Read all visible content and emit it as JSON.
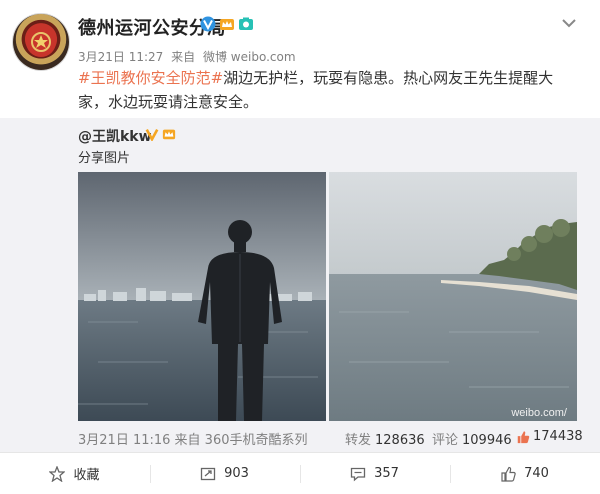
{
  "header": {
    "author": "德州运河公安分局",
    "badges": [
      "verified-v-icon",
      "crown-icon",
      "camera-icon"
    ]
  },
  "meta": {
    "time": "3月21日 11:27",
    "via_prefix": "来自",
    "source": "微博 weibo.com"
  },
  "content": {
    "topic": "#王凯教你安全防范#",
    "text": "湖边无护栏，玩耍有隐患。热心网友王先生提醒大家，水边玩耍请注意安全。"
  },
  "repost": {
    "user": "@王凯kkw",
    "text": "分享图片",
    "time": "3月21日 11:16 来自 360手机奇酷系列",
    "repost_label": "转发",
    "repost_count": "128636",
    "comment_label": "评论",
    "comment_count": "109946",
    "like_count": "174438",
    "watermark": "weibo.com/"
  },
  "actions": {
    "favorite": "收藏",
    "repost_count": "903",
    "comment_count": "357",
    "like_count": "740"
  },
  "colors": {
    "topic": "#eb7350",
    "verified": "#f5a623",
    "repost_bg": "#f2f2f5"
  }
}
